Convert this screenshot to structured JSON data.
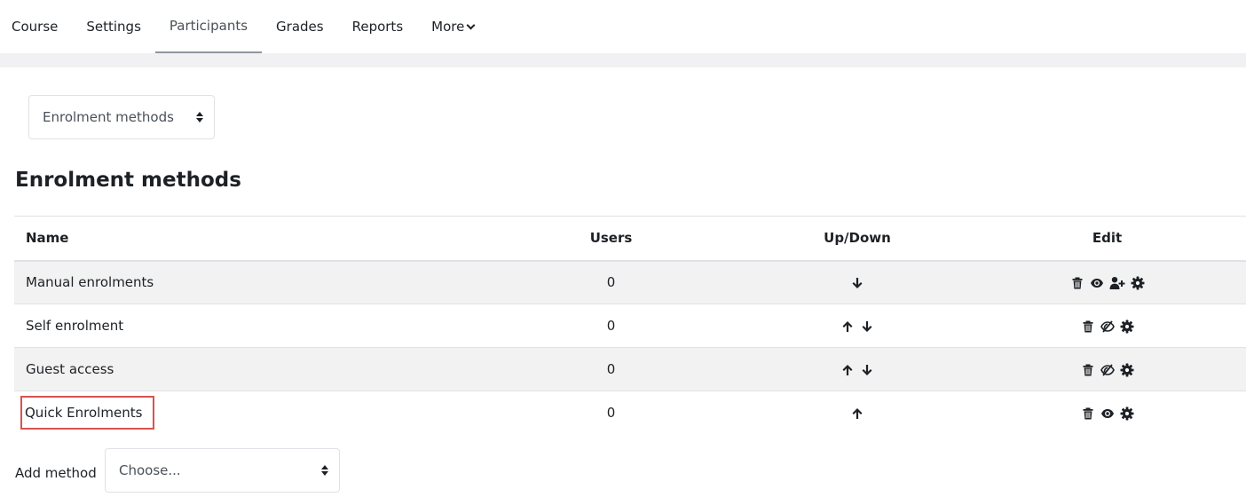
{
  "nav": {
    "tabs": [
      {
        "label": "Course"
      },
      {
        "label": "Settings"
      },
      {
        "label": "Participants"
      },
      {
        "label": "Grades"
      },
      {
        "label": "Reports"
      },
      {
        "label": "More"
      }
    ],
    "active_tab": "Participants"
  },
  "selector": {
    "value": "Enrolment methods"
  },
  "page_title": "Enrolment methods",
  "table": {
    "headers": {
      "name": "Name",
      "users": "Users",
      "updown": "Up/Down",
      "edit": "Edit"
    },
    "rows": [
      {
        "name": "Manual enrolments",
        "users": "0",
        "arrows": [
          "arrow-down-icon"
        ],
        "edit_icons": [
          "trash-icon",
          "eye-icon",
          "user-plus-icon",
          "gear-icon"
        ],
        "enabled": true
      },
      {
        "name": "Self enrolment",
        "users": "0",
        "arrows": [
          "arrow-up-icon",
          "arrow-down-icon"
        ],
        "edit_icons": [
          "trash-icon",
          "eye-slash-icon",
          "gear-icon"
        ],
        "enabled": false
      },
      {
        "name": "Guest access",
        "users": "0",
        "arrows": [
          "arrow-up-icon",
          "arrow-down-icon"
        ],
        "edit_icons": [
          "trash-icon",
          "eye-slash-icon",
          "gear-icon"
        ],
        "enabled": false
      },
      {
        "name": "Quick Enrolments",
        "users": "0",
        "arrows": [
          "arrow-up-icon"
        ],
        "edit_icons": [
          "trash-icon",
          "eye-icon",
          "gear-icon"
        ],
        "enabled": true,
        "highlighted": true
      }
    ]
  },
  "add_method": {
    "label": "Add method",
    "placeholder": "Choose..."
  },
  "colors": {
    "highlight": "#d9534f",
    "text": "#1d2125",
    "dimmed": "#6a737b",
    "stripe": "#f2f2f2"
  }
}
